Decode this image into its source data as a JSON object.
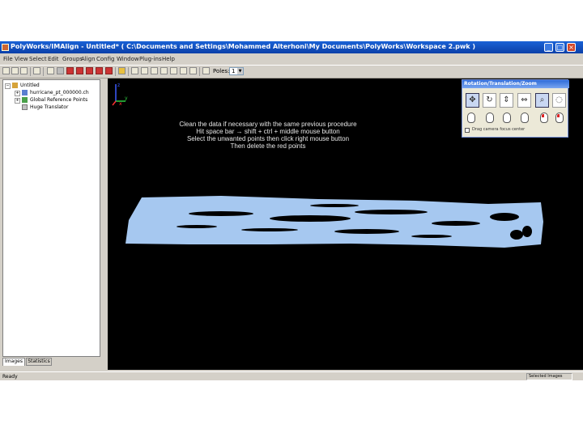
{
  "window": {
    "title": "PolyWorks/IMAlign - Untitled* ( C:\\Documents and Settings\\Mohammed Alterhoni\\My Documents\\PolyWorks\\Workspace 2.pwk )",
    "controls": [
      "_",
      "□",
      "×"
    ]
  },
  "menubar": {
    "items": [
      "File",
      "View",
      "Select",
      "Edit",
      "Groups",
      "Align",
      "Config",
      "Window",
      "Plug-ins",
      "Help"
    ]
  },
  "toolbar": {
    "poles_label": "Poles:",
    "poles_value": "1"
  },
  "tree": {
    "root": "Untitled",
    "items": [
      "hurricane_pt_000000.ch",
      "Global Reference Points",
      "Huge Translator"
    ]
  },
  "panel_tabs": [
    "Images",
    "Statistics"
  ],
  "viewport": {
    "axis_labels": {
      "z": "z",
      "x": "x",
      "y": "y"
    },
    "instructions": [
      "Clean the data if necessary with the same previous procedure",
      "Hit space bar → shift + ctrl + middle mouse button",
      "Select the unwanted points then click right mouse button",
      "Then delete the red points"
    ]
  },
  "rtz_panel": {
    "title": "Rotation/Translation/Zoom",
    "icons": [
      "rotate-xyz-icon",
      "rotate-z-icon",
      "translate-xy-icon",
      "translate-z-icon",
      "zoom-icon",
      "rotate-center-icon"
    ],
    "checkbox_label": "Drag camera focus center",
    "checked": false
  },
  "statusbar": {
    "left": "Ready",
    "right": "Selected Images"
  },
  "colors": {
    "viewport_bg": "#000000",
    "point_cloud": "#a6c8f0",
    "titlebar": "#0a3fa8",
    "chrome": "#d4d0c8"
  }
}
